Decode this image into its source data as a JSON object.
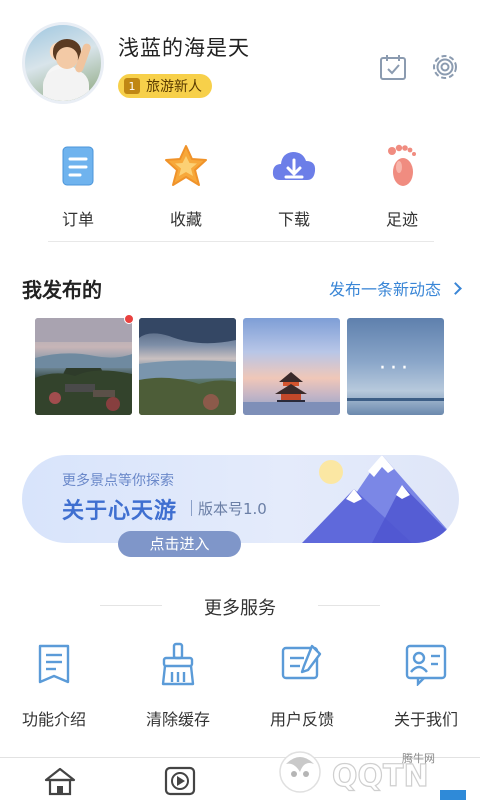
{
  "profile": {
    "username": "浅蓝的海是天",
    "badge_level": "1",
    "badge_label": "旅游新人"
  },
  "header_icons": [
    "calendar-check-icon",
    "gear-icon"
  ],
  "quick_actions": [
    {
      "label": "订单",
      "icon": "order-icon",
      "color": "#6fb3ee"
    },
    {
      "label": "收藏",
      "icon": "star-icon",
      "color": "#f7a83a"
    },
    {
      "label": "下载",
      "icon": "cloud-download-icon",
      "color": "#6c7ee8"
    },
    {
      "label": "足迹",
      "icon": "footprint-icon",
      "color": "#f08c80"
    }
  ],
  "my_posts": {
    "title": "我发布的",
    "publish_link": "发布一条新动态",
    "more_indicator": "···"
  },
  "banner": {
    "subtitle": "更多景点等你探索",
    "title": "关于心天游",
    "version": "版本号1.0",
    "button": "点击进入"
  },
  "more_services": {
    "title": "更多服务",
    "items": [
      {
        "label": "功能介绍",
        "icon": "document-icon"
      },
      {
        "label": "清除缓存",
        "icon": "broom-icon"
      },
      {
        "label": "用户反馈",
        "icon": "feedback-icon"
      },
      {
        "label": "关于我们",
        "icon": "contact-card-icon"
      }
    ]
  },
  "watermark": {
    "site": "腾牛网",
    "brand": "QQTN"
  },
  "colors": {
    "accent_blue": "#3a86d6",
    "badge_gold": "#f7d04a",
    "banner_title": "#3f6fd0",
    "icon_blue": "#5b9bd8"
  }
}
